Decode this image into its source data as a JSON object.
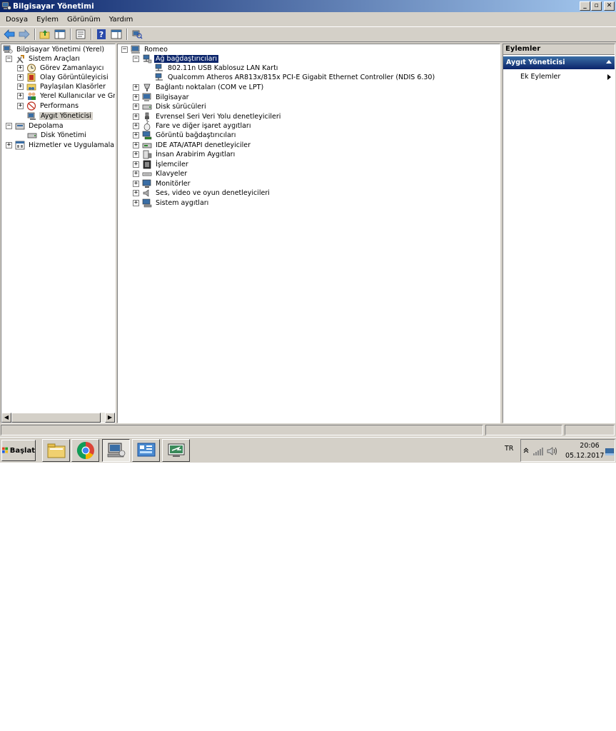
{
  "window": {
    "title": "Bilgisayar Yönetimi"
  },
  "menu": [
    "Dosya",
    "Eylem",
    "Görünüm",
    "Yardım"
  ],
  "left_tree": {
    "root": "Bilgisayar Yönetimi (Yerel)",
    "system_tools": "Sistem Araçları",
    "task_scheduler": "Görev Zamanlayıcı",
    "event_viewer": "Olay Görüntüleyicisi",
    "shared_folders": "Paylaşılan Klasörler",
    "local_users": "Yerel Kullanıcılar ve Grupla",
    "performance": "Performans",
    "device_manager": "Aygıt Yöneticisi",
    "storage": "Depolama",
    "disk_management": "Disk Yönetimi",
    "services": "Hizmetler ve Uygulamalar"
  },
  "device_tree": {
    "computer": "Romeo",
    "network_adapters": "Ağ bağdaştırıcıları",
    "adapters": [
      "802.11n USB Kablosuz LAN Kartı",
      "Qualcomm Atheros AR813x/815x PCI-E Gigabit Ethernet Controller (NDIS 6.30)"
    ],
    "categories": [
      "Bağlantı noktaları (COM ve LPT)",
      "Bilgisayar",
      "Disk sürücüleri",
      "Evrensel Seri Veri Yolu denetleyicileri",
      "Fare ve diğer işaret aygıtları",
      "Görüntü bağdaştırıcıları",
      "IDE ATA/ATAPI denetleyiciler",
      "İnsan Arabirim Aygıtları",
      "İşlemciler",
      "Klavyeler",
      "Monitörler",
      "Ses, video ve oyun denetleyicileri",
      "Sistem aygıtları"
    ]
  },
  "actions": {
    "header": "Eylemler",
    "section": "Aygıt Yöneticisi",
    "more": "Ek Eylemler"
  },
  "taskbar": {
    "start": "Başlat",
    "language": "TR",
    "time": "20:06",
    "date": "05.12.2017"
  },
  "colors": {
    "title_gradient_start": "#0a246a",
    "title_gradient_end": "#a6caf0",
    "selection": "#0a246a",
    "chrome": "#d4d0c8"
  }
}
